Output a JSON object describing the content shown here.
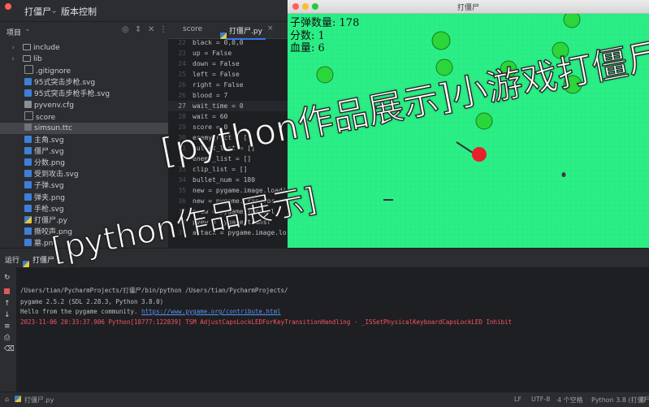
{
  "ide": {
    "project_name": "打僵尸",
    "vcs_label": "版本控制",
    "project_view_label": "项目"
  },
  "project_tree": [
    {
      "label": "include",
      "icon": "folder-icon"
    },
    {
      "label": "lib",
      "icon": "folder-icon"
    },
    {
      "label": ".gitignore",
      "icon": "file-icon"
    },
    {
      "label": "95式突击步枪.svg",
      "icon": "svg-icon"
    },
    {
      "label": "95式突击步枪手枪.svg",
      "icon": "svg-icon"
    },
    {
      "label": "pyvenv.cfg",
      "icon": "cfg-icon"
    },
    {
      "label": "score",
      "icon": "file-icon"
    },
    {
      "label": "simsun.ttc",
      "icon": "font-file-icon"
    },
    {
      "label": "主角.svg",
      "icon": "svg-icon"
    },
    {
      "label": "僵尸.svg",
      "icon": "svg-icon"
    },
    {
      "label": "分数.png",
      "icon": "svg-icon"
    },
    {
      "label": "受到攻击.svg",
      "icon": "svg-icon"
    },
    {
      "label": "子弹.svg",
      "icon": "svg-icon"
    },
    {
      "label": "弹夹.png",
      "icon": "svg-icon"
    },
    {
      "label": "手枪.svg",
      "icon": "svg-icon"
    },
    {
      "label": "打僵尸.py",
      "icon": "python-file-icon"
    },
    {
      "label": "撕咬声.png",
      "icon": "svg-icon"
    },
    {
      "label": "墓.png",
      "icon": "svg-icon"
    }
  ],
  "editor": {
    "tabs": [
      {
        "label": "score",
        "active": false
      },
      {
        "label": "打僵尸.py",
        "active": true
      }
    ],
    "lines": [
      {
        "num": "22",
        "text": "black = 0,0,0"
      },
      {
        "num": "23",
        "text": "up = False"
      },
      {
        "num": "24",
        "text": "down = False"
      },
      {
        "num": "25",
        "text": "left = False"
      },
      {
        "num": "26",
        "text": "right = False"
      },
      {
        "num": "26",
        "text": "blood = 7"
      },
      {
        "num": "27",
        "text": "wait_time = 0"
      },
      {
        "num": "28",
        "text": "wait = 60"
      },
      {
        "num": "29",
        "text": "score = 0"
      },
      {
        "num": "30",
        "text": "enemy_rect = []"
      },
      {
        "num": "31",
        "text": "bullet_list = []"
      },
      {
        "num": "32",
        "text": "enemy_list = []"
      },
      {
        "num": "33",
        "text": "clip_list = []"
      },
      {
        "num": "34",
        "text": "bullet_num = 180"
      },
      {
        "num": "35",
        "text": "new = pygame.image.load("
      },
      {
        "num": "36",
        "text": "new = pygame.transfor"
      },
      {
        "num": "37",
        "text": "pvew = pygame.image.l"
      },
      {
        "num": "38",
        "text": "pvew = pygame.transf"
      },
      {
        "num": "39",
        "text": "attack = pygame.image.lo"
      }
    ]
  },
  "run_panel": {
    "tab_run": "运行",
    "tab_file": "打僵尸",
    "console": [
      {
        "text": "/Users/tian/PycharmProjects/打僵尸/bin/python /Users/tian/PycharmProjects/",
        "type": "normal"
      },
      {
        "text": "pygame 2.5.2 (SDL 2.28.3, Python 3.8.0)",
        "type": "normal"
      },
      {
        "text": "Hello from the pygame community. ",
        "link": "https://www.pygame.org/contribute.html",
        "type": "normal"
      },
      {
        "text": "2023-11-06 20:33:37.906 Python[18777:122839] TSM AdjustCapsLockLEDForKeyTransitionHandling - _ISSetPhysicalKeyboardCapsLockLED Inhibit",
        "type": "error"
      }
    ]
  },
  "statusbar": {
    "file": "打僵尸.py",
    "line_sep": "LF",
    "encoding": "UTF-8",
    "indent": "4 个空格",
    "interpreter": "Python 3.8 (打僵尸)"
  },
  "game": {
    "window_title": "打僵尸",
    "hud": {
      "bullets_label": "子弹数量:",
      "bullets_value": "178",
      "score_label": "分数:",
      "score_value": "1",
      "health_label": "血量:",
      "health_value": "6"
    },
    "background_color": "#2aee85",
    "bush_color": "#2bd63a"
  },
  "overlay": {
    "caption_line1": "[python作品展示]小游戏打僵尸",
    "caption_line2": "[python作品展示]"
  }
}
